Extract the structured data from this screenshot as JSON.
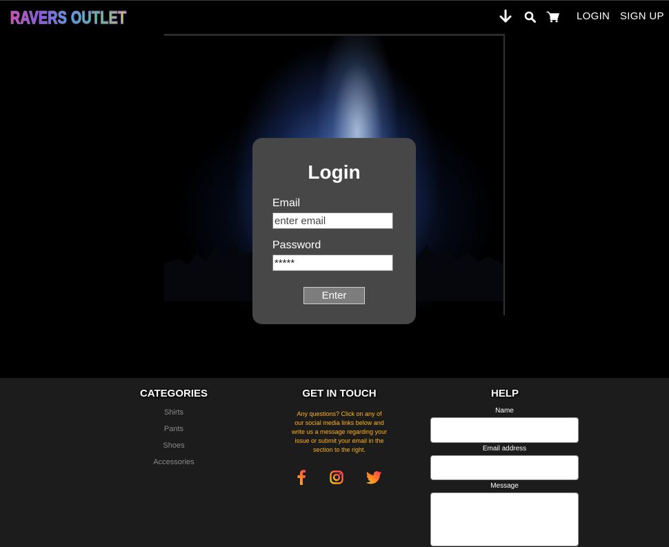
{
  "header": {
    "logo": "RAVERS OUTLET",
    "icons": [
      "arrow-down-icon",
      "search-icon",
      "cart-icon"
    ],
    "login_label": "LOGIN",
    "signup_label": "SIGN UP"
  },
  "login": {
    "title": "Login",
    "email_label": "Email",
    "email_placeholder": "enter email",
    "password_label": "Password",
    "password_value": "*****",
    "enter_label": "Enter"
  },
  "footer": {
    "categories": {
      "title": "CATEGORIES",
      "items": [
        "Shirts",
        "Pants",
        "Shoes",
        "Accessories"
      ]
    },
    "contact": {
      "title": "GET IN TOUCH",
      "lines": [
        "Any questions? Click on any of",
        "our social media links below and",
        "write us a message regarding your",
        "issue or submit your email in the",
        "section to the right."
      ],
      "socials": [
        "facebook-icon",
        "instagram-icon",
        "twitter-icon"
      ]
    },
    "help": {
      "title": "HELP",
      "name_label": "Name",
      "email_label": "Email address",
      "message_label": "Message"
    }
  },
  "colors": {
    "accent_orange": "#ffb21a",
    "social_start": "#ff8a1f",
    "social_end": "#ff3d5a",
    "card_bg": "#474747",
    "footer_bg": "#1c1c1c"
  }
}
